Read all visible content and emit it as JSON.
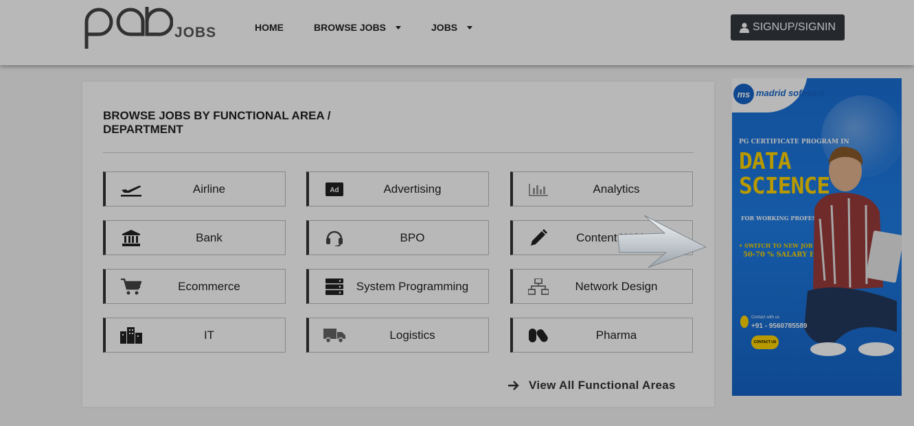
{
  "header": {
    "logo_text": "pab",
    "logo_suffix": "JOBS",
    "nav": [
      {
        "label": "HOME",
        "dropdown": false
      },
      {
        "label": "BROWSE JOBS",
        "dropdown": true
      },
      {
        "label": "JOBS",
        "dropdown": true
      }
    ],
    "signin_label": "SIGNUP/SIGNIN"
  },
  "browse": {
    "title": "BROWSE JOBS BY FUNCTIONAL AREA / DEPARTMENT",
    "tiles": [
      {
        "label": "Airline",
        "icon": "plane-departure-icon"
      },
      {
        "label": "Advertising",
        "icon": "ad-icon"
      },
      {
        "label": "Analytics",
        "icon": "bar-chart-icon"
      },
      {
        "label": "Bank",
        "icon": "bank-icon"
      },
      {
        "label": "BPO",
        "icon": "headset-icon"
      },
      {
        "label": "Content Writing",
        "icon": "pencil-icon"
      },
      {
        "label": "Ecommerce",
        "icon": "shopping-cart-icon"
      },
      {
        "label": "System Programming",
        "icon": "server-icon"
      },
      {
        "label": "Network Design",
        "icon": "network-icon"
      },
      {
        "label": "IT",
        "icon": "building-icon"
      },
      {
        "label": "Logistics",
        "icon": "truck-icon"
      },
      {
        "label": "Pharma",
        "icon": "pills-icon"
      }
    ],
    "view_all_label": "View All Functional Areas"
  },
  "ad": {
    "brand_short": "ms",
    "brand_name": "madrid software",
    "program_line": "PG CERTIFICATE PROGRAM IN",
    "headline_1": "DATA",
    "headline_2": "SCIENCE",
    "audience": "FOR WORKING PROFESSIONALS",
    "bullet": "• SWITCH TO NEW JOB WITH",
    "hike": "50-70 % SALARY HIKE",
    "contact_label": "Contact with us",
    "phone": "+91 - 9560785589",
    "cta": "CONTACT US"
  }
}
